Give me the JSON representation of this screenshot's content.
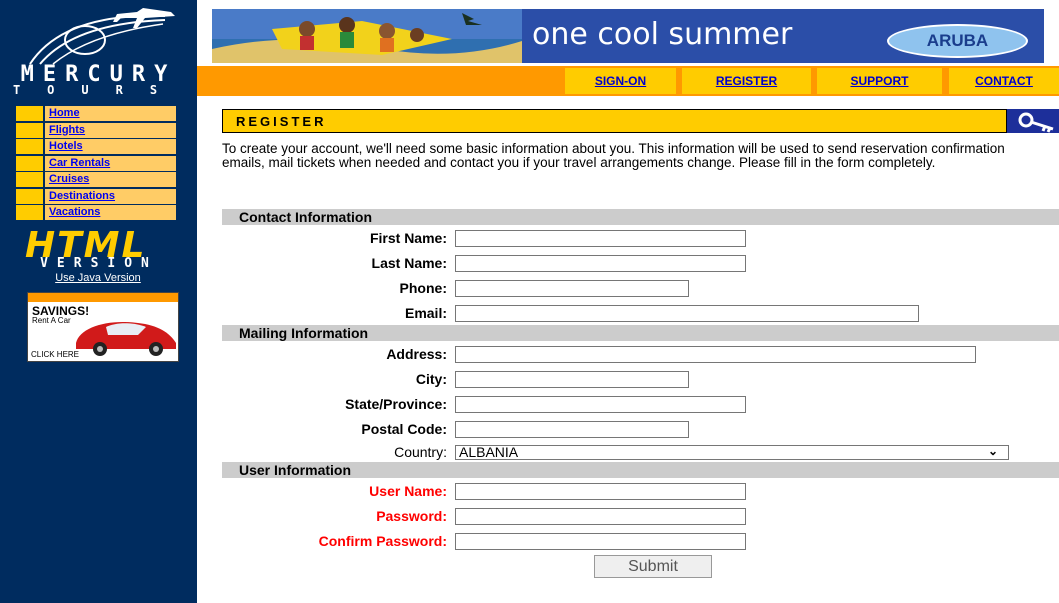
{
  "brand": {
    "wordmark": "MERCURY",
    "wordmark_sub": "TOURS"
  },
  "sidebar": {
    "items": [
      {
        "label": "Home"
      },
      {
        "label": "Flights"
      },
      {
        "label": "Hotels"
      },
      {
        "label": "Car Rentals"
      },
      {
        "label": "Cruises"
      },
      {
        "label": "Destinations"
      },
      {
        "label": "Vacations"
      }
    ],
    "html_logo": "HTML",
    "version_label": "VERSION",
    "java_link": "Use Java Version",
    "ad": {
      "title": "SAVINGS!",
      "subtitle": "Rent A Car",
      "cta": "CLICK HERE"
    }
  },
  "banner": {
    "tagline": "one cool summer",
    "brand": "ARUBA"
  },
  "topnav": {
    "signon": "SIGN-ON",
    "register": "REGISTER",
    "support": "SUPPORT",
    "contact": "CONTACT"
  },
  "page": {
    "title": "REGISTER",
    "intro": "To create your account, we'll need some basic information about you. This information will be used to send reservation confirmation emails, mail tickets when needed and contact you if your travel arrangements change. Please fill in the form completely."
  },
  "form": {
    "contact_section": "Contact Information",
    "first_name_label": "First Name:",
    "last_name_label": "Last Name:",
    "phone_label": "Phone:",
    "email_label": "Email:",
    "mailing_section": "Mailing Information",
    "address_label": "Address:",
    "city_label": "City:",
    "state_label": "State/Province:",
    "postal_label": "Postal Code:",
    "country_label": "Country:",
    "country_value": "ALBANIA",
    "user_section": "User Information",
    "username_label": "User Name:",
    "password_label": "Password:",
    "confirm_label": "Confirm Password:",
    "submit_label": "Submit"
  },
  "colors": {
    "sidebar_bg": "#002c5f",
    "accent_orange": "#ff9900",
    "accent_yellow": "#ffcc00",
    "required_red": "#ff0000"
  }
}
